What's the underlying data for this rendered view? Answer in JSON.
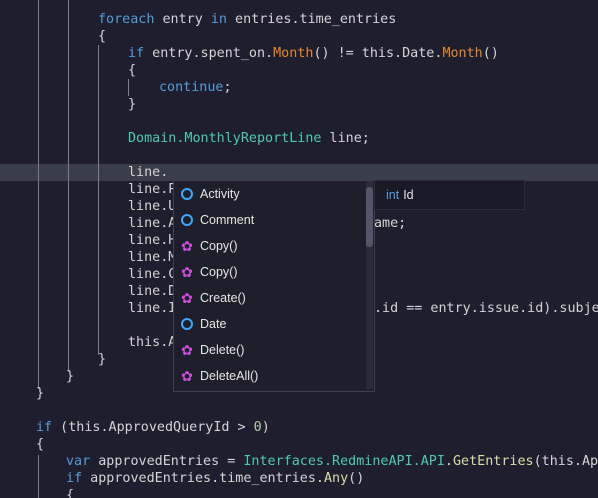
{
  "code": {
    "l1": {
      "kw1": "foreach",
      "t1": " entry ",
      "kw2": "in",
      "t2": " entries.time_entries"
    },
    "l2": "{",
    "l3": {
      "kw": "if",
      "t1": " entry.spent_on.",
      "m1": "Month",
      "t2": "() != this.Date.",
      "m2": "Month",
      "t3": "()"
    },
    "l4": "{",
    "l5": {
      "kw": "continue",
      "t": ";"
    },
    "l6": "}",
    "l7": {
      "tp": "Domain.MonthlyReportLine",
      "t": " line;"
    },
    "l8": "line.",
    "l9": "line.P",
    "l10": "line.U",
    "l11": {
      "a": "line.A",
      "b": "ame;"
    },
    "l12": "line.H",
    "l13": "line.M",
    "l14": "line.C",
    "l15": "line.D",
    "l16": {
      "a": "line.I",
      "b": ".id == entry.issue.id).subjec"
    },
    "l17": "this.A",
    "l18": "}",
    "l19": "}",
    "l20": "}",
    "l21": {
      "kw": "if",
      "t1": " (this.ApprovedQueryId > ",
      "nu": "0",
      "t2": ")"
    },
    "l22": "{",
    "l23": {
      "kw": "var",
      "t1": " approvedEntries = ",
      "tp": "Interfaces.RedmineAPI.API",
      "t2": ".",
      "fn": "GetEntries",
      "t3": "(this.Appro"
    },
    "l24": {
      "kw": "if",
      "t1": " approvedEntries.time_entries.",
      "fn": "Any",
      "t2": "()"
    },
    "l25": "{"
  },
  "completion": {
    "items": [
      {
        "label": "Activity",
        "icon": "property-icon"
      },
      {
        "label": "Comment",
        "icon": "property-icon"
      },
      {
        "label": "Copy()",
        "icon": "method-icon"
      },
      {
        "label": "Copy()",
        "icon": "method-icon"
      },
      {
        "label": "Create()",
        "icon": "method-icon"
      },
      {
        "label": "Date",
        "icon": "property-icon"
      },
      {
        "label": "Delete()",
        "icon": "method-icon"
      },
      {
        "label": "DeleteAll()",
        "icon": "method-icon"
      }
    ]
  },
  "tooltip": {
    "type": "int",
    "name": "Id"
  }
}
